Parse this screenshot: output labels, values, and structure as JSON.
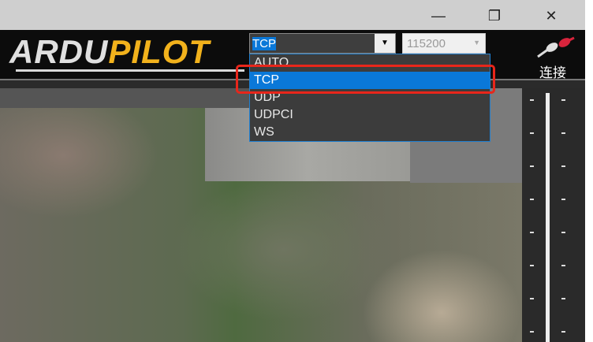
{
  "window": {
    "minimize": "—",
    "restore": "❐",
    "close": "✕"
  },
  "logo": {
    "part1": "ARDU",
    "part2": "PILOT"
  },
  "connection": {
    "type_value": "TCP",
    "baud_value": "115200",
    "options": [
      "AUTO",
      "TCP",
      "UDP",
      "UDPCI",
      "WS"
    ],
    "selected_index": 1
  },
  "connect_label": "连接",
  "colors": {
    "highlight": "#0a78d8",
    "annotation": "#e8261b",
    "logo_orange": "#f2b21c"
  }
}
